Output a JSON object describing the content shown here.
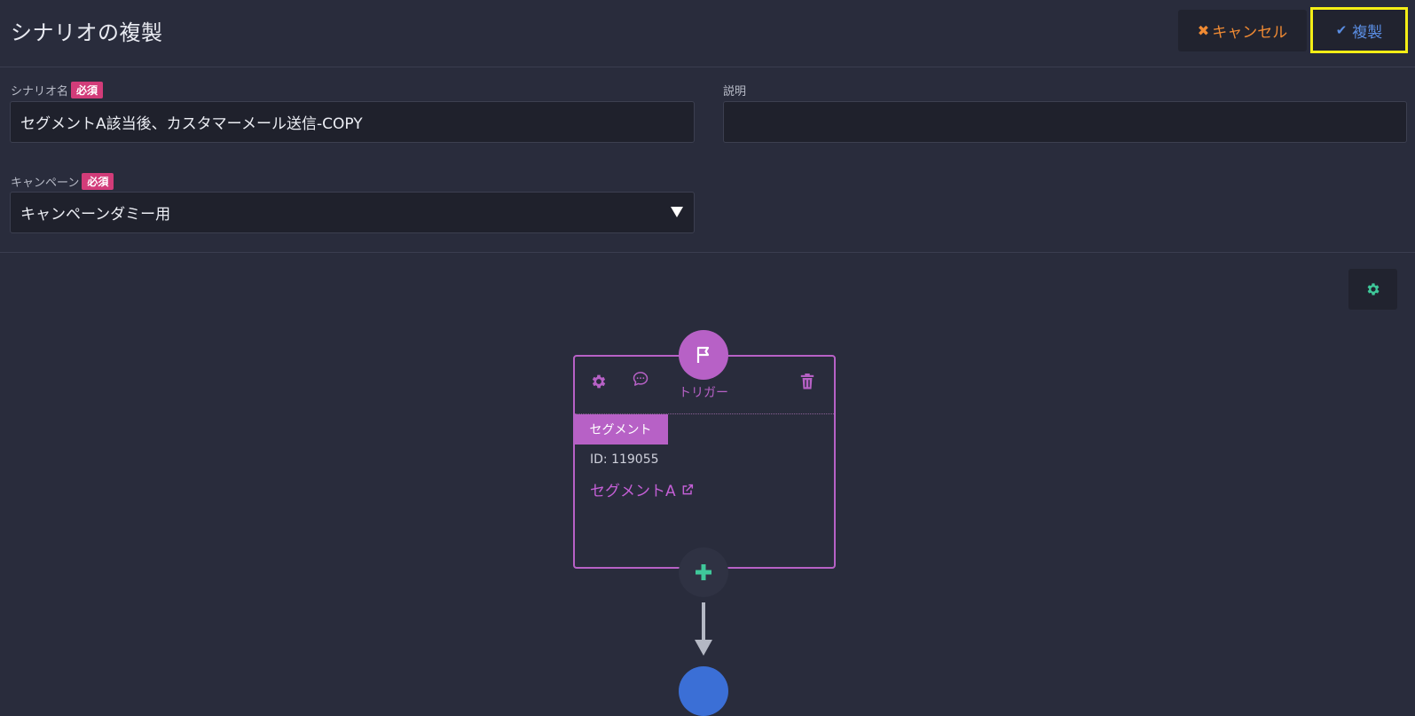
{
  "header": {
    "title": "シナリオの複製",
    "cancel_label": "キャンセル",
    "copy_label": "複製"
  },
  "form": {
    "scenario_name_label": "シナリオ名",
    "required_badge": "必須",
    "scenario_name_value": "セグメントA該当後、カスタマーメール送信-COPY",
    "description_label": "説明",
    "description_value": "",
    "campaign_label": "キャンペーン",
    "campaign_value": "キャンペーンダミー用"
  },
  "flow": {
    "trigger_label": "トリガー",
    "segment_tag": "セグメント",
    "segment_id": "ID: 119055",
    "segment_name": "セグメントA"
  },
  "colors": {
    "accent_purple": "#b761c6",
    "cancel_orange": "#f08a33",
    "copy_blue": "#5a8de2",
    "highlight_yellow": "#f4ee16",
    "add_green": "#3fc89a",
    "required_pink": "#d23c79"
  }
}
